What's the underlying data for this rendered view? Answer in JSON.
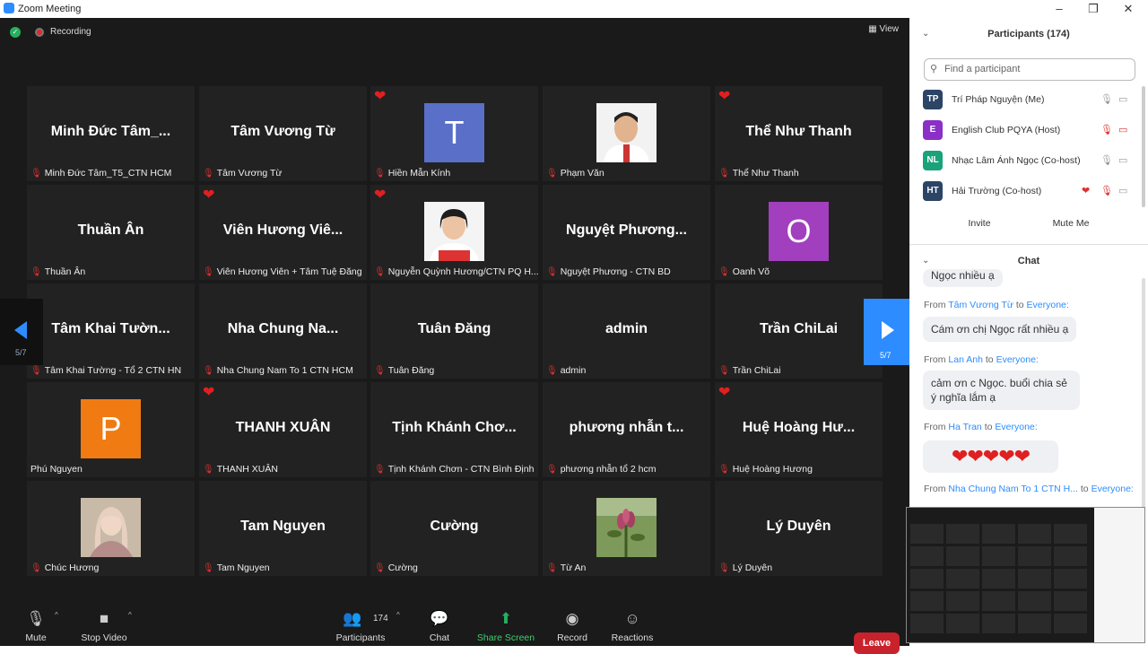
{
  "window": {
    "title": "Zoom Meeting",
    "controls": [
      "–",
      "❐",
      "✕"
    ]
  },
  "meeting": {
    "recording": "Recording",
    "view": "View"
  },
  "tiles": [
    {
      "big": "Minh Đức Tâm_...",
      "label": "Minh Đức Tâm_T5_CTN HCM"
    },
    {
      "big": "Tâm Vương Từ",
      "label": "Tâm Vương Từ"
    },
    {
      "avatar": "T",
      "color": "#5a6fc8",
      "heart": true,
      "label": "Hiền Mẫn Kính"
    },
    {
      "photo": "man",
      "label": "Phạm Văn"
    },
    {
      "big": "Thể Như Thanh",
      "heart": true,
      "label": "Thể Như Thanh"
    },
    {
      "big": "Thuần Ân",
      "label": "Thuần Ân"
    },
    {
      "big": "Viên Hương Viê...",
      "heart": true,
      "label": "Viên Hương Viên + Tâm Tuệ Đăng"
    },
    {
      "photo": "woman",
      "heart": true,
      "label": "Nguyễn Quỳnh Hương/CTN PQ H..."
    },
    {
      "big": "Nguyệt Phương...",
      "label": "Nguyệt Phương - CTN BD"
    },
    {
      "avatar": "O",
      "color": "#a23fbf",
      "label": "Oanh Võ"
    },
    {
      "big": "Tâm Khai Tườn...",
      "label": "Tâm Khai Tường - Tổ 2 CTN HN"
    },
    {
      "big": "Nha Chung Na...",
      "label": "Nha Chung Nam To 1 CTN HCM"
    },
    {
      "big": "Tuân Đăng",
      "label": "Tuân Đăng"
    },
    {
      "big": "admin",
      "label": "admin"
    },
    {
      "big": "Trần ChiLai",
      "label": "Trần ChiLai"
    },
    {
      "avatar": "P",
      "color": "#f07b12",
      "label": "Phú Nguyen",
      "nomic": true
    },
    {
      "big": "THANH XUÂN",
      "heart": true,
      "label": "THANH XUÂN"
    },
    {
      "big": "Tịnh Khánh Chơ...",
      "label": "Tịnh Khánh Chơn - CTN Bình Định"
    },
    {
      "big": "phương nhẫn t...",
      "label": "phương nhẫn tổ 2 hcm"
    },
    {
      "big": "Huệ Hoàng Hư...",
      "heart": true,
      "label": "Huệ Hoàng Hương"
    },
    {
      "photo": "girl",
      "label": "Chúc Hương"
    },
    {
      "big": "Tam Nguyen",
      "label": "Tam Nguyen"
    },
    {
      "big": "Cường",
      "label": "Cường"
    },
    {
      "photo": "flower",
      "label": "Từ An"
    },
    {
      "big": "Lý Duyên",
      "label": "Lý Duyên"
    }
  ],
  "pager": {
    "left": "5/7",
    "right": "5/7"
  },
  "toolbar": {
    "mute": "Mute",
    "stop_video": "Stop Video",
    "participants": "Participants",
    "participants_count": "174",
    "chat": "Chat",
    "share_screen": "Share Screen",
    "record": "Record",
    "reactions": "Reactions",
    "leave": "Leave"
  },
  "participants_panel": {
    "title": "Participants (174)",
    "search_placeholder": "Find a participant",
    "rows": [
      {
        "initials": "TP",
        "color": "#2c4466",
        "name": "Trí Pháp Nguyện (Me)"
      },
      {
        "initials": "E",
        "color": "#8b2fc9",
        "name": "English Club PQYA (Host)"
      },
      {
        "initials": "NL",
        "color": "#1aa37a",
        "name": "Nhạc Lâm Ánh Ngọc (Co-host)"
      },
      {
        "initials": "HT",
        "color": "#2c4466",
        "name": "Hải Trường (Co-host)"
      }
    ],
    "invite": "Invite",
    "mute_me": "Mute Me"
  },
  "chat_panel": {
    "title": "Chat",
    "partial": "Ngọc nhiều ạ",
    "messages": [
      {
        "from": "Tâm Vương Từ",
        "to": "Everyone:",
        "text": "Cám ơn chị Ngọc rất nhiều ạ"
      },
      {
        "from": "Lan Anh",
        "to": "Everyone:",
        "text": "cảm ơn c Ngọc. buổi chia sẻ ý nghĩa lắm ạ"
      },
      {
        "from": "Ha Tran",
        "to": "Everyone:",
        "text": "❤❤❤❤❤"
      },
      {
        "from": "Nha Chung Nam To 1 CTN H...",
        "to": "Everyone:"
      }
    ],
    "from_word": "From",
    "to_word": "to"
  },
  "colors": {
    "accent": "#2d8cff",
    "leave": "#c8232c",
    "share": "#27ae60",
    "dark": "#1a1a1a"
  }
}
